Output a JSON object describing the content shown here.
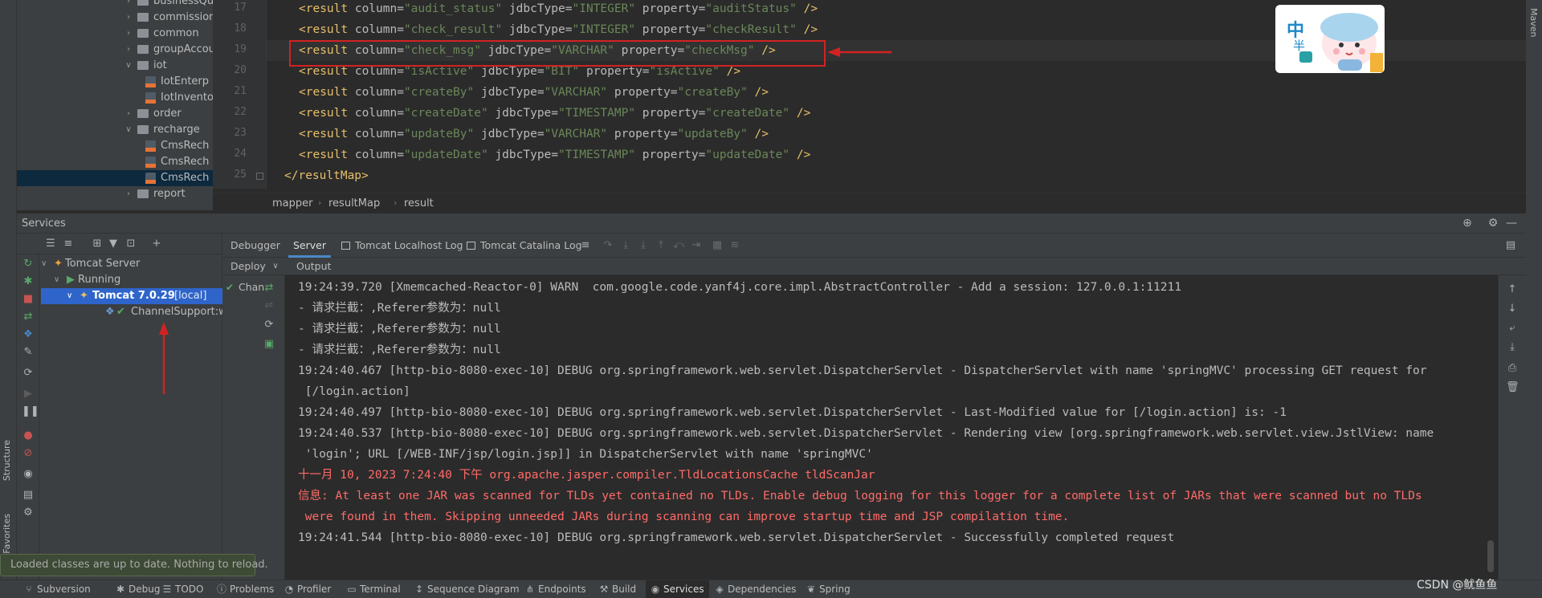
{
  "left_strip": {
    "structure_label": "Structure",
    "favorites_label": "Favorites"
  },
  "right_strip": {
    "maven_label": "Maven"
  },
  "project_tree": {
    "items": [
      {
        "label": "businessQue",
        "kind": "folder",
        "depth": 1,
        "expanded": false
      },
      {
        "label": "commissionl",
        "kind": "folder",
        "depth": 1,
        "expanded": false
      },
      {
        "label": "common",
        "kind": "folder",
        "depth": 1,
        "expanded": false
      },
      {
        "label": "groupAccou",
        "kind": "folder",
        "depth": 1,
        "expanded": false
      },
      {
        "label": "iot",
        "kind": "folder",
        "depth": 1,
        "expanded": true
      },
      {
        "label": "IotEnterp",
        "kind": "xml",
        "depth": 2
      },
      {
        "label": "IotInvento",
        "kind": "xml",
        "depth": 2
      },
      {
        "label": "order",
        "kind": "folder",
        "depth": 1,
        "expanded": false
      },
      {
        "label": "recharge",
        "kind": "folder",
        "depth": 1,
        "expanded": true
      },
      {
        "label": "CmsRech",
        "kind": "xml",
        "depth": 2
      },
      {
        "label": "CmsRech",
        "kind": "xml",
        "depth": 2
      },
      {
        "label": "CmsRech",
        "kind": "xml",
        "depth": 2,
        "selected": true
      },
      {
        "label": "report",
        "kind": "folder",
        "depth": 1,
        "expanded": false
      }
    ]
  },
  "editor": {
    "lines": [
      {
        "num": "17",
        "column": "audit_status",
        "jdbcType": "INTEGER",
        "property": "auditStatus"
      },
      {
        "num": "18",
        "column": "check_result",
        "jdbcType": "INTEGER",
        "property": "checkResult"
      },
      {
        "num": "19",
        "column": "check_msg",
        "jdbcType": "VARCHAR",
        "property": "checkMsg"
      },
      {
        "num": "20",
        "column": "isActive",
        "jdbcType": "BIT",
        "property": "isActive"
      },
      {
        "num": "21",
        "column": "createBy",
        "jdbcType": "VARCHAR",
        "property": "createBy"
      },
      {
        "num": "22",
        "column": "createDate",
        "jdbcType": "TIMESTAMP",
        "property": "createDate"
      },
      {
        "num": "23",
        "column": "updateBy",
        "jdbcType": "VARCHAR",
        "property": "updateBy"
      },
      {
        "num": "24",
        "column": "updateDate",
        "jdbcType": "TIMESTAMP",
        "property": "updateDate"
      }
    ],
    "closing_line": {
      "num": "25",
      "text": "</resultMap>"
    },
    "highlighted_line_index": 2,
    "sticker": {
      "char1": "中",
      "char2": "半"
    }
  },
  "breadcrumb": [
    "mapper",
    "resultMap",
    "result"
  ],
  "services": {
    "title": "Services",
    "tree": {
      "tomcat_server": "Tomcat Server",
      "running": "Running",
      "tomcat_instance": "Tomcat 7.0.29",
      "tomcat_instance_suffix": "[local]",
      "artifact": "ChannelSupport:wa"
    },
    "tabs": [
      "Debugger",
      "Server",
      "Tomcat Localhost Log",
      "Tomcat Catalina Log"
    ],
    "active_tab": "Server",
    "subtabs": {
      "deploy": "Deploy",
      "output": "Output"
    },
    "deploy_item": "Chan",
    "console_lines": [
      {
        "text": "19:24:39.720 [Xmemcached-Reactor-0] WARN  com.google.code.yanf4j.core.impl.AbstractController - Add a session: 127.0.0.1:11211",
        "level": "info"
      },
      {
        "text": "- 请求拦截：,Referer参数为：null",
        "level": "info"
      },
      {
        "text": "- 请求拦截：,Referer参数为：null",
        "level": "info"
      },
      {
        "text": "- 请求拦截：,Referer参数为：null",
        "level": "info"
      },
      {
        "text": "19:24:40.467 [http-bio-8080-exec-10] DEBUG org.springframework.web.servlet.DispatcherServlet - DispatcherServlet with name 'springMVC' processing GET request for",
        "level": "info"
      },
      {
        "text": " [/login.action]",
        "level": "info"
      },
      {
        "text": "19:24:40.497 [http-bio-8080-exec-10] DEBUG org.springframework.web.servlet.DispatcherServlet - Last-Modified value for [/login.action] is: -1",
        "level": "info"
      },
      {
        "text": "19:24:40.537 [http-bio-8080-exec-10] DEBUG org.springframework.web.servlet.DispatcherServlet - Rendering view [org.springframework.web.servlet.view.JstlView: name",
        "level": "info"
      },
      {
        "text": " 'login'; URL [/WEB-INF/jsp/login.jsp]] in DispatcherServlet with name 'springMVC'",
        "level": "info"
      },
      {
        "text": "十一月 10, 2023 7:24:40 下午 org.apache.jasper.compiler.TldLocationsCache tldScanJar",
        "level": "error"
      },
      {
        "text": "信息: At least one JAR was scanned for TLDs yet contained no TLDs. Enable debug logging for this logger for a complete list of JARs that were scanned but no TLDs",
        "level": "error"
      },
      {
        "text": " were found in them. Skipping unneeded JARs during scanning can improve startup time and JSP compilation time.",
        "level": "error"
      },
      {
        "text": "19:24:41.544 [http-bio-8080-exec-10] DEBUG org.springframework.web.servlet.DispatcherServlet - Successfully completed request",
        "level": "info"
      }
    ]
  },
  "toast": "Loaded classes are up to date. Nothing to reload.",
  "status_bar": {
    "items": [
      "Subversion",
      "Debug",
      "TODO",
      "Problems",
      "Profiler",
      "Terminal",
      "Sequence Diagram",
      "Endpoints",
      "Build",
      "Services",
      "Dependencies",
      "Spring"
    ],
    "active": "Services",
    "watermark": "CSDN @鱿鱼鱼"
  },
  "colors": {
    "tag": "#e8bf6a",
    "attribute": "#bababa",
    "string": "#6a8759",
    "error": "#ff6b68",
    "selection": "#2f65ca",
    "annotation_red": "#d32222",
    "running_green": "#59a869"
  }
}
